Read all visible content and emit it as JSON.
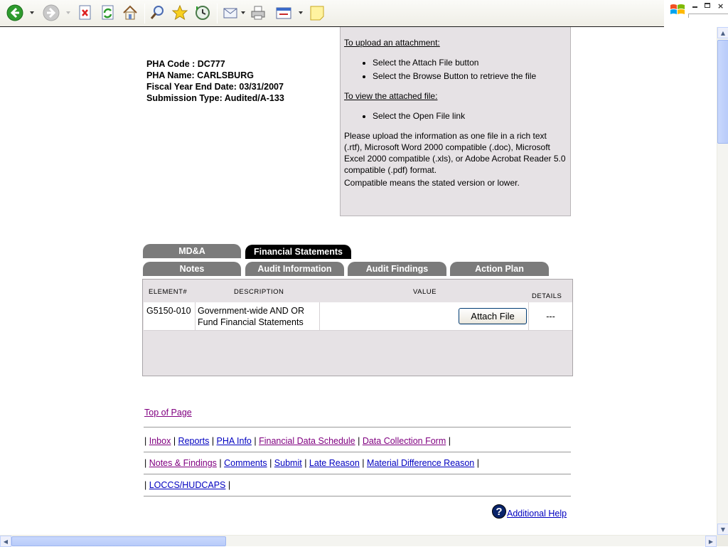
{
  "toolbar": {
    "icons": [
      "back-icon",
      "forward-icon",
      "stop-icon",
      "refresh-icon",
      "home-icon",
      "search-icon",
      "favorites-icon",
      "history-icon",
      "mail-icon",
      "print-icon",
      "edit-icon",
      "notes-icon"
    ]
  },
  "pha": {
    "code": "PHA Code : DC777",
    "name": "PHA Name: CARLSBURG",
    "fiscal": "Fiscal Year End Date: 03/31/2007",
    "submission": "Submission Type: Audited/A-133"
  },
  "instructions": {
    "upload_heading": "To upload an attachment:",
    "upload_steps": [
      "Select the Attach File button",
      "Select the Browse Button to retrieve the file"
    ],
    "view_heading": "To view the attached file:",
    "view_steps": [
      "Select the Open File link"
    ],
    "note": "Please upload the information as one file in a rich text (.rtf), Microsoft Word 2000 compatible (.doc), Microsoft Excel 2000 compatible (.xls), or Adobe Acrobat Reader 5.0 compatible (.pdf) format.",
    "compat": "Compatible means the stated version or lower."
  },
  "tabs": {
    "row1": [
      "MD&A",
      "Financial Statements"
    ],
    "row2": [
      "Notes",
      "Audit Information",
      "Audit Findings",
      "Action Plan"
    ],
    "active": "Financial Statements"
  },
  "table": {
    "headers": {
      "element": "ELEMENT#",
      "description": "DESCRIPTION",
      "value": "VALUE",
      "details": "DETAILS"
    },
    "rows": [
      {
        "element": "G5150-010",
        "description_line1": "Government-wide AND OR",
        "description_line2": "Fund Financial Statements",
        "button": "Attach File",
        "details": "---"
      }
    ]
  },
  "footer": {
    "top_of_page": "Top of Page",
    "row1": [
      "Inbox",
      "Reports",
      "PHA Info",
      "Financial Data Schedule",
      "Data Collection Form"
    ],
    "row2": [
      "Notes & Findings",
      "Comments",
      "Submit",
      "Late Reason",
      "Material Difference Reason"
    ],
    "row3": [
      "LOCCS/HUDCAPS"
    ],
    "help": "Additional Help",
    "separator": "|"
  }
}
